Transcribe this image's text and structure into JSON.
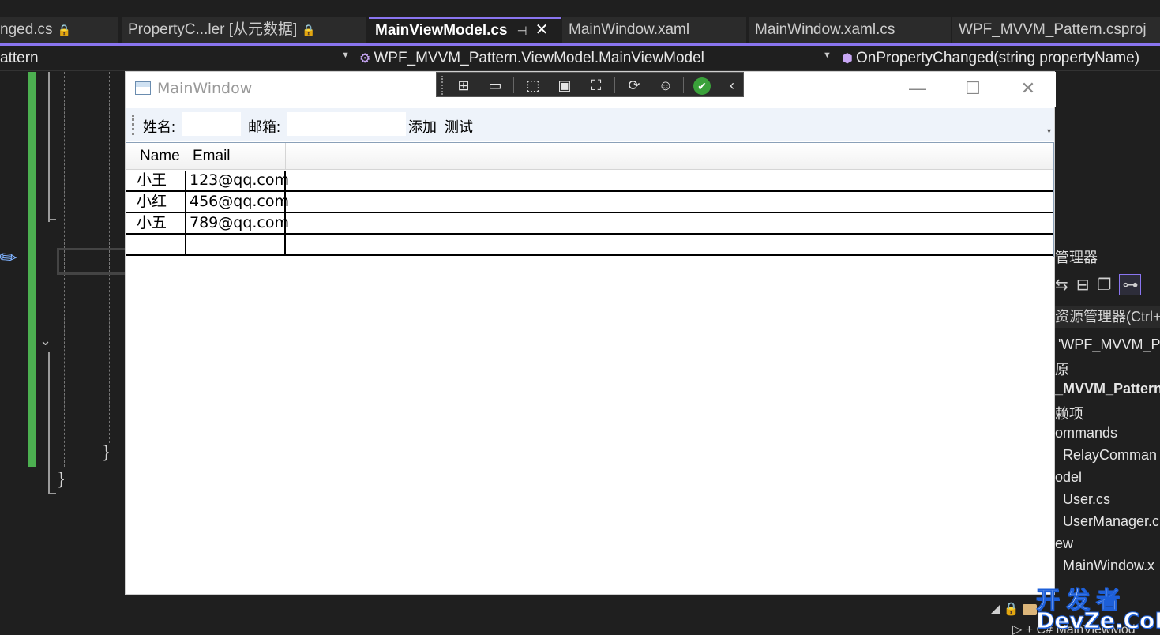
{
  "ide": {
    "tabs": [
      {
        "label": "nged.cs",
        "locked": true
      },
      {
        "label": "PropertyC...ler [从元数据]",
        "locked": true
      },
      {
        "label": "MainViewModel.cs",
        "active": true
      },
      {
        "label": "MainWindow.xaml"
      },
      {
        "label": "MainWindow.xaml.cs"
      },
      {
        "label": "WPF_MVVM_Pattern.csproj"
      }
    ],
    "lock_glyph": "🔒",
    "pin_glyph": "⊣",
    "close_glyph": "✕",
    "navbar": {
      "project": "attern",
      "type": "WPF_MVVM_Pattern.ViewModel.MainViewModel",
      "member": "OnPropertyChanged(string propertyName)"
    },
    "editor": {
      "closing_brace_inner": "}",
      "closing_brace_outer": "}"
    },
    "accent_color": "#8a75f0",
    "change_bar_color": "#4caf50"
  },
  "solution_explorer": {
    "title": "管理器",
    "search_placeholder": "资源管理器(Ctrl+",
    "items": [
      {
        "label": "'WPF_MVVM_P",
        "bold": false
      },
      {
        "label": "原",
        "bold": false
      },
      {
        "label": "_MVVM_Pattern",
        "bold": true
      },
      {
        "label": "赖项",
        "bold": false
      },
      {
        "label": "ommands",
        "bold": false
      },
      {
        "label": "RelayComman",
        "bold": false
      },
      {
        "label": "odel",
        "bold": false
      },
      {
        "label": "User.cs",
        "bold": false
      },
      {
        "label": "UserManager.c",
        "bold": false
      },
      {
        "label": "ew",
        "bold": false
      },
      {
        "label": "MainWindow.x",
        "bold": false
      }
    ],
    "bottom_row": "MainViewMod"
  },
  "window": {
    "title": "MainWindow",
    "minimize": "—",
    "maximize": "☐",
    "close": "✕",
    "toolbar": {
      "name_label": "姓名:",
      "name_value": "",
      "email_label": "邮箱:",
      "email_value": "",
      "add_button": "添加",
      "test_button": "测试",
      "overflow": "▾"
    },
    "grid": {
      "columns": [
        "Name",
        "Email"
      ],
      "rows": [
        [
          "小王",
          "123@qq.com"
        ],
        [
          "小红",
          "456@qq.com"
        ],
        [
          "小五",
          "789@qq.com"
        ],
        [
          "",
          ""
        ]
      ]
    }
  },
  "debug_toolbar": {
    "icons": [
      "select-element-icon",
      "record-icon",
      "pointer-select-icon",
      "layout-adorner-icon",
      "track-focus-icon",
      "hot-reload-icon",
      "accessibility-icon",
      "checkmark-icon",
      "collapse-icon"
    ]
  },
  "watermark": {
    "top": "开发者",
    "bottom": "DevZe.CoM"
  }
}
